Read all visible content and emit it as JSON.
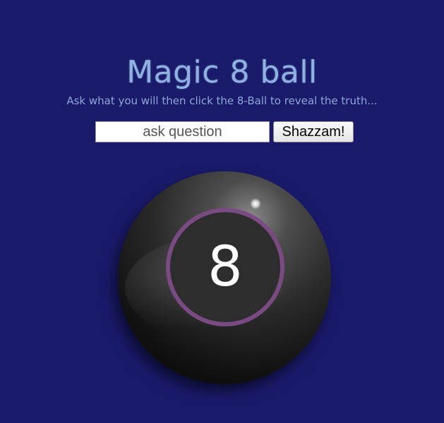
{
  "page": {
    "title": "Magic 8 ball",
    "subtitle": "Ask what you will then click the 8-Ball to reveal the truth..."
  },
  "form": {
    "question_placeholder": "ask question",
    "question_value": "",
    "submit_label": "Shazzam!"
  },
  "ball": {
    "display_text": "8"
  },
  "colors": {
    "background": "#1a1a6b",
    "title": "#8fb2e0",
    "ring": "#7a4a82"
  }
}
